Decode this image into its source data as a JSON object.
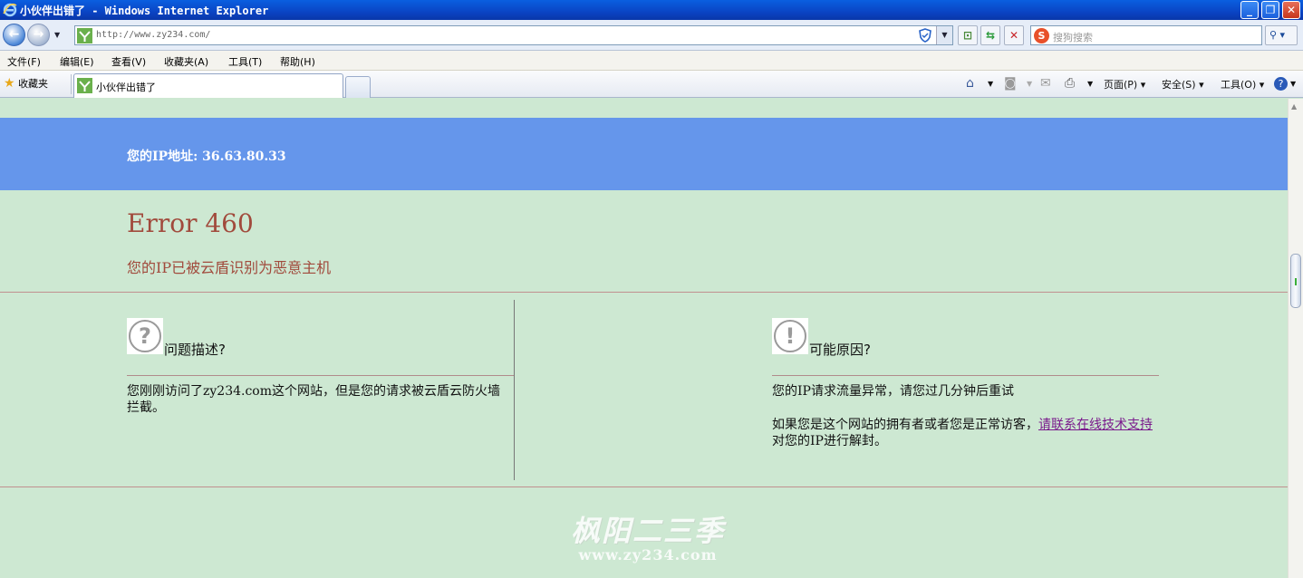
{
  "window": {
    "title": "小伙伴出错了 - Windows Internet Explorer",
    "controls": [
      "minimize",
      "maximize",
      "close"
    ]
  },
  "address_bar": {
    "url": "http://www.zy234.com/",
    "search_placeholder": "搜狗搜索"
  },
  "menu": {
    "items": [
      "文件(F)",
      "编辑(E)",
      "查看(V)",
      "收藏夹(A)",
      "工具(T)",
      "帮助(H)"
    ]
  },
  "tabs": {
    "favorites_label": "收藏夹",
    "active_tab": "小伙伴出错了"
  },
  "command_bar": {
    "page": "页面(P)",
    "safety": "安全(S)",
    "tools": "工具(O)"
  },
  "page": {
    "ip_line": "您的IP地址: 36.63.80.33",
    "error_title": "Error 460",
    "error_subtitle": "您的IP已被云盾识别为恶意主机",
    "left": {
      "heading": "问题描述?",
      "text": "您刚刚访问了zy234.com这个网站，但是您的请求被云盾云防火墙拦截。"
    },
    "right": {
      "heading": "可能原因?",
      "text1": "您的IP请求流量异常，请您过几分钟后重试",
      "text2_prefix": "如果您是这个网站的拥有者或者您是正常访客，",
      "link": "请联系在线技术支持",
      "text2_suffix": "对您的IP进行解封。"
    },
    "watermark_line1": "枫阳二三季",
    "watermark_line2": "www.zy234.com"
  },
  "colors": {
    "page_bg": "#cde8d2",
    "blue_bar": "#6596eb",
    "error_text": "#a14a3c",
    "link": "#7a1a8c"
  }
}
